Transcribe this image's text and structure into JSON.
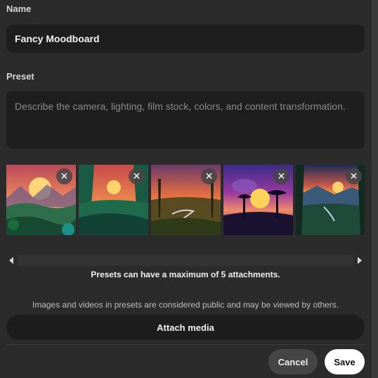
{
  "form": {
    "name_label": "Name",
    "name_value": "Fancy Moodboard",
    "preset_label": "Preset",
    "preset_placeholder": "Describe the camera, lighting, film stock, colors, and content transformation.",
    "preset_value": ""
  },
  "attachments": {
    "items": [
      {
        "kind": "image",
        "remove_icon": "close-icon",
        "palette": {
          "sky": "#e8705a",
          "sun": "#ffd77a",
          "land": "#1f5a3a"
        }
      },
      {
        "kind": "image",
        "remove_icon": "close-icon",
        "palette": {
          "sky": "#e46f4f",
          "sun": "#ffd36b",
          "land": "#16503f"
        }
      },
      {
        "kind": "image",
        "remove_icon": "close-icon",
        "palette": {
          "sky": "#c5553c",
          "sun": "#f8b24c",
          "land": "#3e3a1e"
        }
      },
      {
        "kind": "image",
        "remove_icon": "close-icon",
        "palette": {
          "sky": "#5b3aa5",
          "sun": "#ffd25c",
          "land": "#1a1230"
        }
      },
      {
        "kind": "image",
        "remove_icon": "close-icon",
        "palette": {
          "sky": "#2a3a6a",
          "sun": "#ff9b3a",
          "land": "#18342e"
        }
      }
    ],
    "remove_glyph": "✕",
    "max_note": "Presets can have a maximum of 5 attachments.",
    "public_note": "Images and videos in presets are considered public and may be viewed by others."
  },
  "actions": {
    "attach_label": "Attach media",
    "cancel_label": "Cancel",
    "save_label": "Save"
  }
}
